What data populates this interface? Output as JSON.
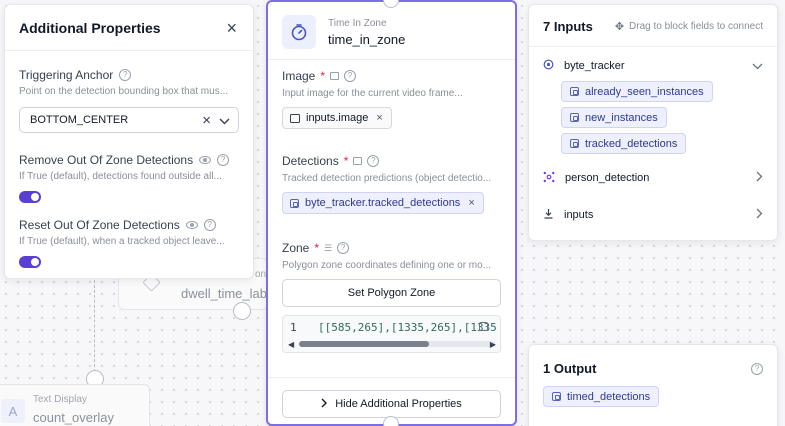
{
  "background_nodes": {
    "dwell_label": "dwell_time_lab",
    "dwell_prefix": "on",
    "text_display_type": "Text Display",
    "text_display_name": "count_overlay",
    "text_display_icon_letter": "A"
  },
  "additional_properties": {
    "title": "Additional Properties",
    "triggering_anchor": {
      "label": "Triggering Anchor",
      "description": "Point on the detection bounding box that mus...",
      "value": "BOTTOM_CENTER"
    },
    "remove_out_of_zone": {
      "label": "Remove Out Of Zone Detections",
      "description": "If True (default), detections found outside all...",
      "enabled": true
    },
    "reset_out_of_zone": {
      "label": "Reset Out Of Zone Detections",
      "description": "If True (default), when a tracked object leave...",
      "enabled": true
    }
  },
  "block": {
    "type": "Time In Zone",
    "name": "time_in_zone",
    "accent_color": "#7b6ee8",
    "image_field": {
      "label": "Image",
      "required_mark": "*",
      "description": "Input image for the current video frame...",
      "value": "inputs.image"
    },
    "detections_field": {
      "label": "Detections",
      "required_mark": "*",
      "description": "Tracked detection predictions (object detectio...",
      "value": "byte_tracker.tracked_detections"
    },
    "zone_field": {
      "label": "Zone",
      "required_mark": "*",
      "description": "Polygon zone coordinates defining one or mo...",
      "button_label": "Set Polygon Zone",
      "code_line_number": "1",
      "code_value": "[[585,265],[1335,265],[1335,"
    },
    "hide_button_label": "Hide Additional Properties"
  },
  "inputs_panel": {
    "title": "7 Inputs",
    "hint": "Drag to block fields to connect",
    "groups": [
      {
        "name": "byte_tracker",
        "expanded": true,
        "outputs": [
          "already_seen_instances",
          "new_instances",
          "tracked_detections"
        ]
      },
      {
        "name": "person_detection",
        "expanded": false
      },
      {
        "name": "inputs",
        "expanded": false
      }
    ]
  },
  "output_panel": {
    "title": "1 Output",
    "outputs": [
      "timed_detections"
    ]
  },
  "colors": {
    "toggle_on": "#5b3fd4",
    "chip_bg": "#eef0fd",
    "chip_text": "#2f3a8f",
    "required": "#e11d48"
  }
}
